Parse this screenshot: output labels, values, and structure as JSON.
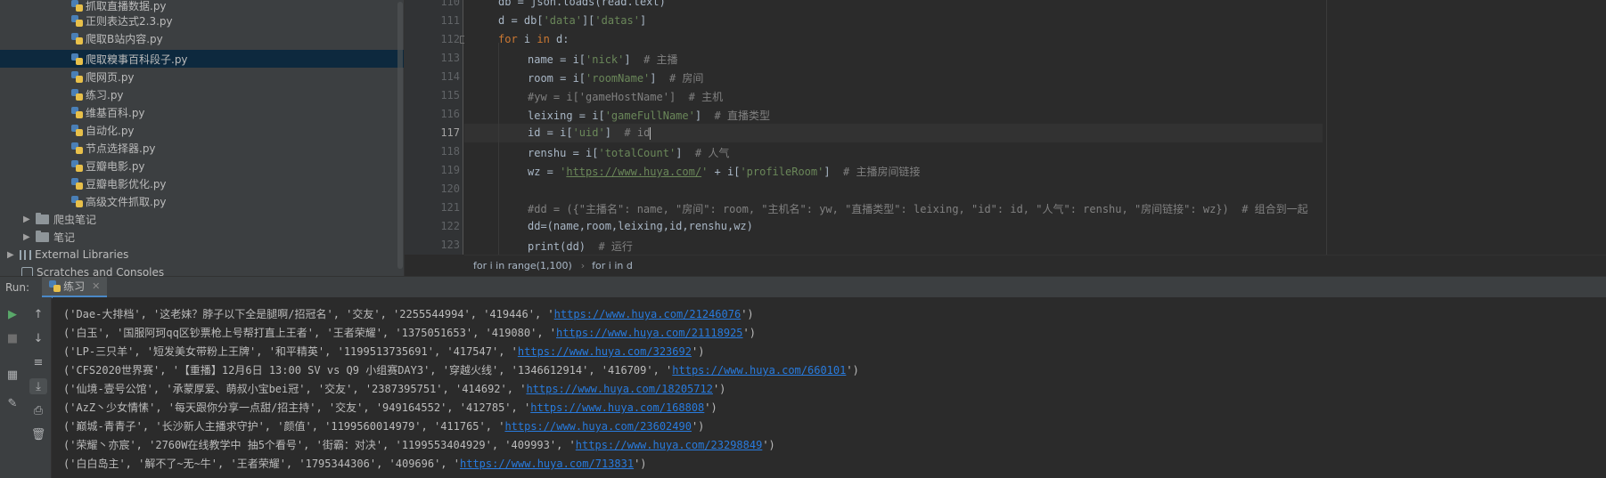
{
  "project_tree": {
    "files": [
      {
        "name": "抓取直播数据.py"
      },
      {
        "name": "正则表达式2.3.py"
      },
      {
        "name": "爬取B站内容.py"
      },
      {
        "name": "爬取糗事百科段子.py",
        "selected": true
      },
      {
        "name": "爬网页.py"
      },
      {
        "name": "练习.py"
      },
      {
        "name": "维基百科.py"
      },
      {
        "name": "自动化.py"
      },
      {
        "name": "节点选择器.py"
      },
      {
        "name": "豆瓣电影.py"
      },
      {
        "name": "豆瓣电影优化.py"
      },
      {
        "name": "高级文件抓取.py"
      }
    ],
    "folders": [
      {
        "name": "爬虫笔记"
      },
      {
        "name": "笔记"
      }
    ],
    "external_libraries": "External Libraries",
    "scratches": "Scratches and Consoles"
  },
  "editor": {
    "current_line": "117",
    "line_numbers": [
      "110",
      "111",
      "112",
      "113",
      "114",
      "115",
      "116",
      "117",
      "118",
      "119",
      "120",
      "121",
      "122",
      "123"
    ],
    "lines": {
      "l110": {
        "a": "db = json.loads(read.text)"
      },
      "l111": {
        "a": "d = db[",
        "s1": "'data'",
        "b": "][",
        "s2": "'datas'",
        "c": "]"
      },
      "l112": {
        "kw1": "for",
        "a": " i ",
        "kw2": "in",
        "b": " d:"
      },
      "l113": {
        "a": "name = i[",
        "s": "'nick'",
        "b": "]  ",
        "c": "# 主播"
      },
      "l114": {
        "a": "room = i[",
        "s": "'roomName'",
        "b": "]  ",
        "c": "# 房间"
      },
      "l115": {
        "c": "#yw = i['gameHostName']  # 主机"
      },
      "l116": {
        "a": "leixing = i[",
        "s": "'gameFullName'",
        "b": "]  ",
        "c": "# 直播类型"
      },
      "l117": {
        "a": "id = i[",
        "s": "'uid'",
        "b": "]  ",
        "c": "# id"
      },
      "l118": {
        "a": "renshu = i[",
        "s": "'totalCount'",
        "b": "]  ",
        "c": "# 人气"
      },
      "l119": {
        "a": "wz = ",
        "s1": "'",
        "url": "https://www.huya.com/",
        "s2": "'",
        "b": " + i[",
        "s3": "'profileRoom'",
        "c": "]  ",
        "cm": "# 主播房间链接"
      },
      "l121": {
        "c": "#dd = ({\"主播名\": name, \"房间\": room, \"主机名\": yw, \"直播类型\": leixing, \"id\": id, \"人气\": renshu, \"房间链接\": wz})  # 组合到一起"
      },
      "l122": {
        "a": "dd=(name,room,leixing,id,renshu,wz)"
      },
      "l123": {
        "a": "print(dd)  ",
        "c": "# 运行"
      }
    }
  },
  "breadcrumb": [
    "for i in range(1,100)",
    "for i in d"
  ],
  "run_panel": {
    "label": "Run:",
    "tab": "练习",
    "output": [
      {
        "text": "('Dae-大排档', '这老妹？脖子以下全是腿啊/招冠名', '交友', '2255544994', '419446', '",
        "url": "https://www.huya.com/21246076",
        "end": "')"
      },
      {
        "text": "('白玉', '国服阿珂qq区钞票枪上号帮打直上王者', '王者荣耀', '1375051653', '419080', '",
        "url": "https://www.huya.com/21118925",
        "end": "')"
      },
      {
        "text": "('LP-三只羊', '短发美女带粉上王牌', '和平精英', '1199513735691', '417547', '",
        "url": "https://www.huya.com/323692",
        "end": "')"
      },
      {
        "text": "('CFS2020世界赛', '【重播】12月6日 13:00 SV vs Q9 小组赛DAY3', '穿越火线', '1346612914', '416709', '",
        "url": "https://www.huya.com/660101",
        "end": "')"
      },
      {
        "text": "('仙境-壹号公馆', '承蒙厚爱、萌叔小宝bei冠', '交友', '2387395751', '414692', '",
        "url": "https://www.huya.com/18205712",
        "end": "')"
      },
      {
        "text": "('AzZ丶少女情愫', '每天跟你分享一点甜/招主持', '交友', '949164552', '412785', '",
        "url": "https://www.huya.com/168808",
        "end": "')"
      },
      {
        "text": "('巅城-青青子', '长沙新人主播求守护', '颜值', '1199560014979', '411765', '",
        "url": "https://www.huya.com/23602490",
        "end": "')"
      },
      {
        "text": "('荣耀丶亦宸', '2760W在线教学中 抽5个看号', '街霸：对决', '1199553404929', '409993', '",
        "url": "https://www.huya.com/23298849",
        "end": "')"
      },
      {
        "text": "('白白岛主', '解不了~无~牛', '王者荣耀', '1795344306', '409696', '",
        "url": "https://www.huya.com/713831",
        "end": "')"
      }
    ]
  },
  "icons": {
    "run": "play-icon",
    "stop": "stop-icon",
    "up": "arrow-up-icon",
    "down": "arrow-down-icon",
    "wrap": "soft-wrap-icon",
    "scroll": "scroll-to-end-icon",
    "print": "print-icon",
    "trash": "trash-icon",
    "layout": "layout-icon",
    "pin": "pin-icon"
  },
  "colors": {
    "keyword": "#cc7832",
    "string": "#6a8759",
    "comment": "#808080",
    "link": "#287bde",
    "selection": "#0d293e"
  }
}
